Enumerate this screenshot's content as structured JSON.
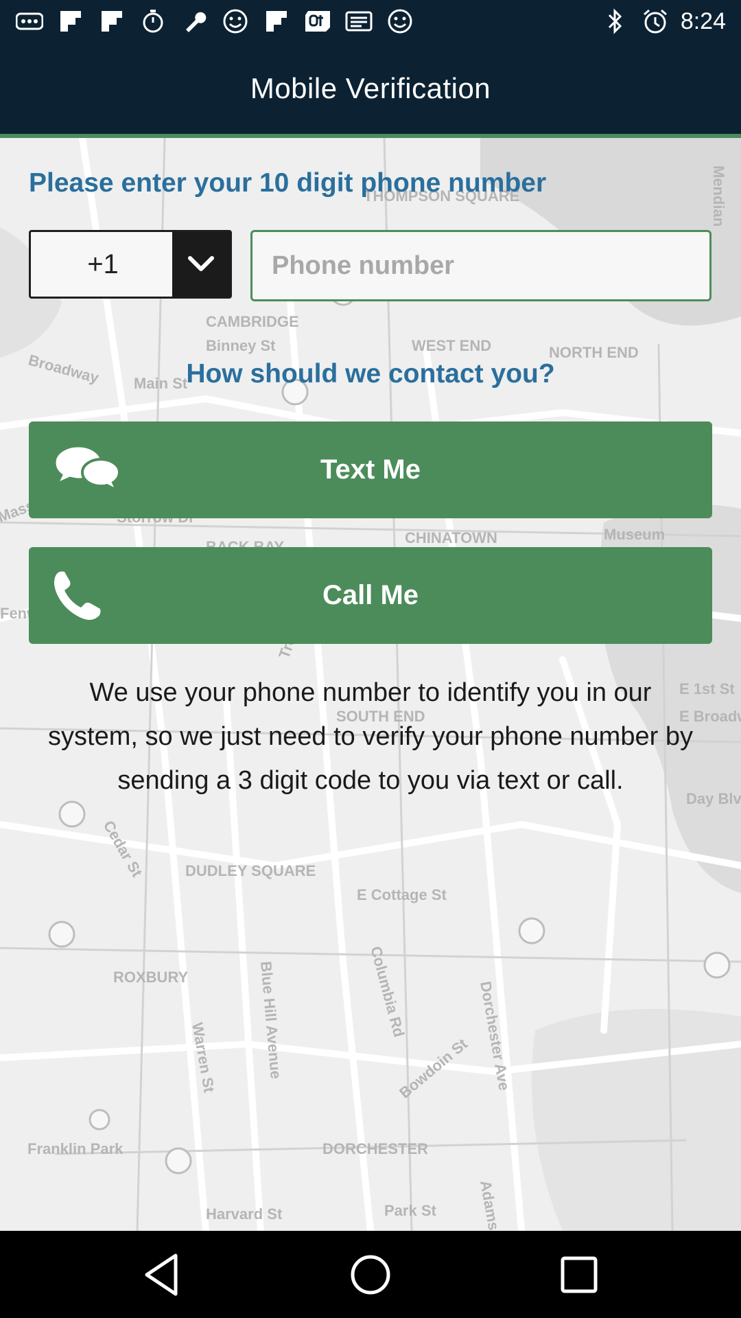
{
  "status_bar": {
    "time": "8:24",
    "icons": [
      "more-icon",
      "flipboard-icon",
      "flipboard-icon",
      "stopwatch-icon",
      "wrench-icon",
      "smiley-icon",
      "flipboard-icon",
      "qt-icon",
      "news-icon",
      "smiley-icon",
      "bluetooth-icon",
      "alarm-icon"
    ]
  },
  "header": {
    "title": "Mobile Verification"
  },
  "form": {
    "prompt": "Please enter your 10 digit phone number",
    "country_code": "+1",
    "phone_placeholder": "Phone number",
    "contact_question": "How should we contact you?",
    "text_me_label": "Text Me",
    "call_me_label": "Call Me",
    "info_text": "We use your phone number to identify you in our system, so we just need to verify your phone number by sending a 3 digit code to you via text or call."
  },
  "map_labels": [
    "THOMPSON SQUARE",
    "CAMBRIDGE",
    "Binney St",
    "WEST END",
    "NORTH END",
    "Main St",
    "BACK BAY",
    "CHINATOWN",
    "Museum",
    "SOUTH END",
    "E 1st St",
    "E Broadway",
    "DUDLEY SQUARE",
    "ROXBURY",
    "E Cottage St",
    "Blue Hill Avenue",
    "Columbia Rd",
    "Dorchester Ave",
    "Franklin Park",
    "DORCHESTER",
    "Harvard St",
    "Park St",
    "Warren St",
    "Bowdoin St",
    "Adams St",
    "Broadway",
    "Storrow Dr",
    "Tremont St",
    "Cedar St",
    "Mendian",
    "Day Blvd",
    "Fenway",
    "Mass Ave"
  ],
  "colors": {
    "header_bg": "#0c2233",
    "accent_green": "#4c8c5a",
    "prompt_blue": "#2a6f9d"
  }
}
